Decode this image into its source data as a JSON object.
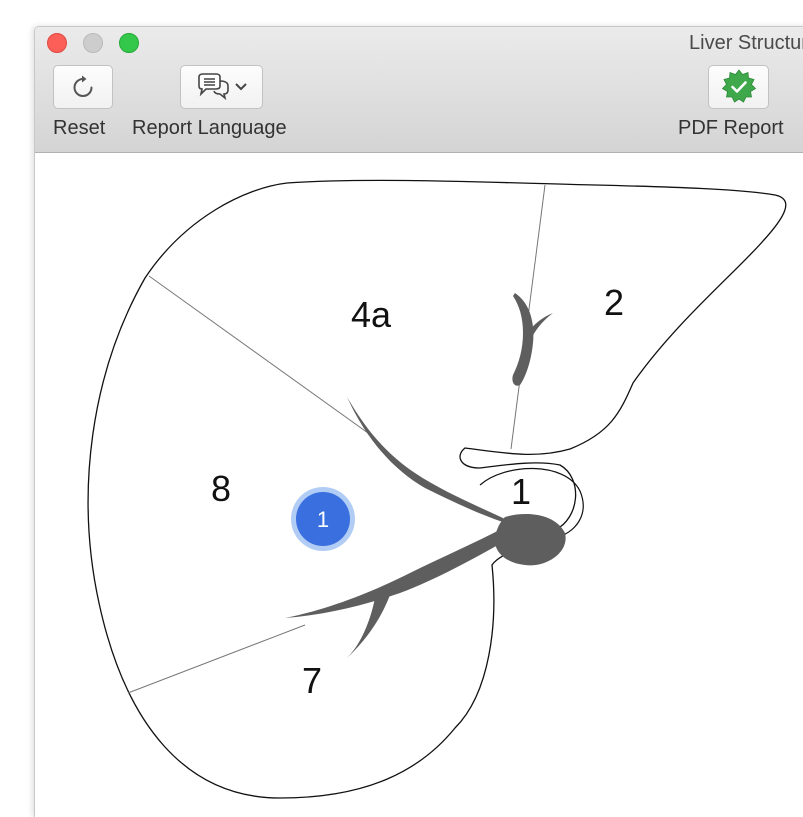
{
  "window": {
    "title": "Liver Structure"
  },
  "toolbar": {
    "reset_label": "Reset",
    "report_language_label": "Report Language",
    "pdf_report_label": "PDF Report"
  },
  "icons": {
    "reset": "circular-arrow-icon",
    "report_language": "speech-bubbles-icon",
    "dropdown": "chevron-down-icon",
    "pdf_report": "green-seal-checkmark-icon"
  },
  "diagram": {
    "segments": {
      "s4a": "4a",
      "s2": "2",
      "s8": "8",
      "s1": "1",
      "s7": "7"
    },
    "marker": {
      "label": "1",
      "color": "#3a6fe0"
    },
    "vessel_color": "#5e5e5e"
  },
  "colors": {
    "close": "#fc5f57",
    "minimize": "#cdcdcd",
    "maximize": "#34c84a",
    "seal": "#3ea84a"
  }
}
